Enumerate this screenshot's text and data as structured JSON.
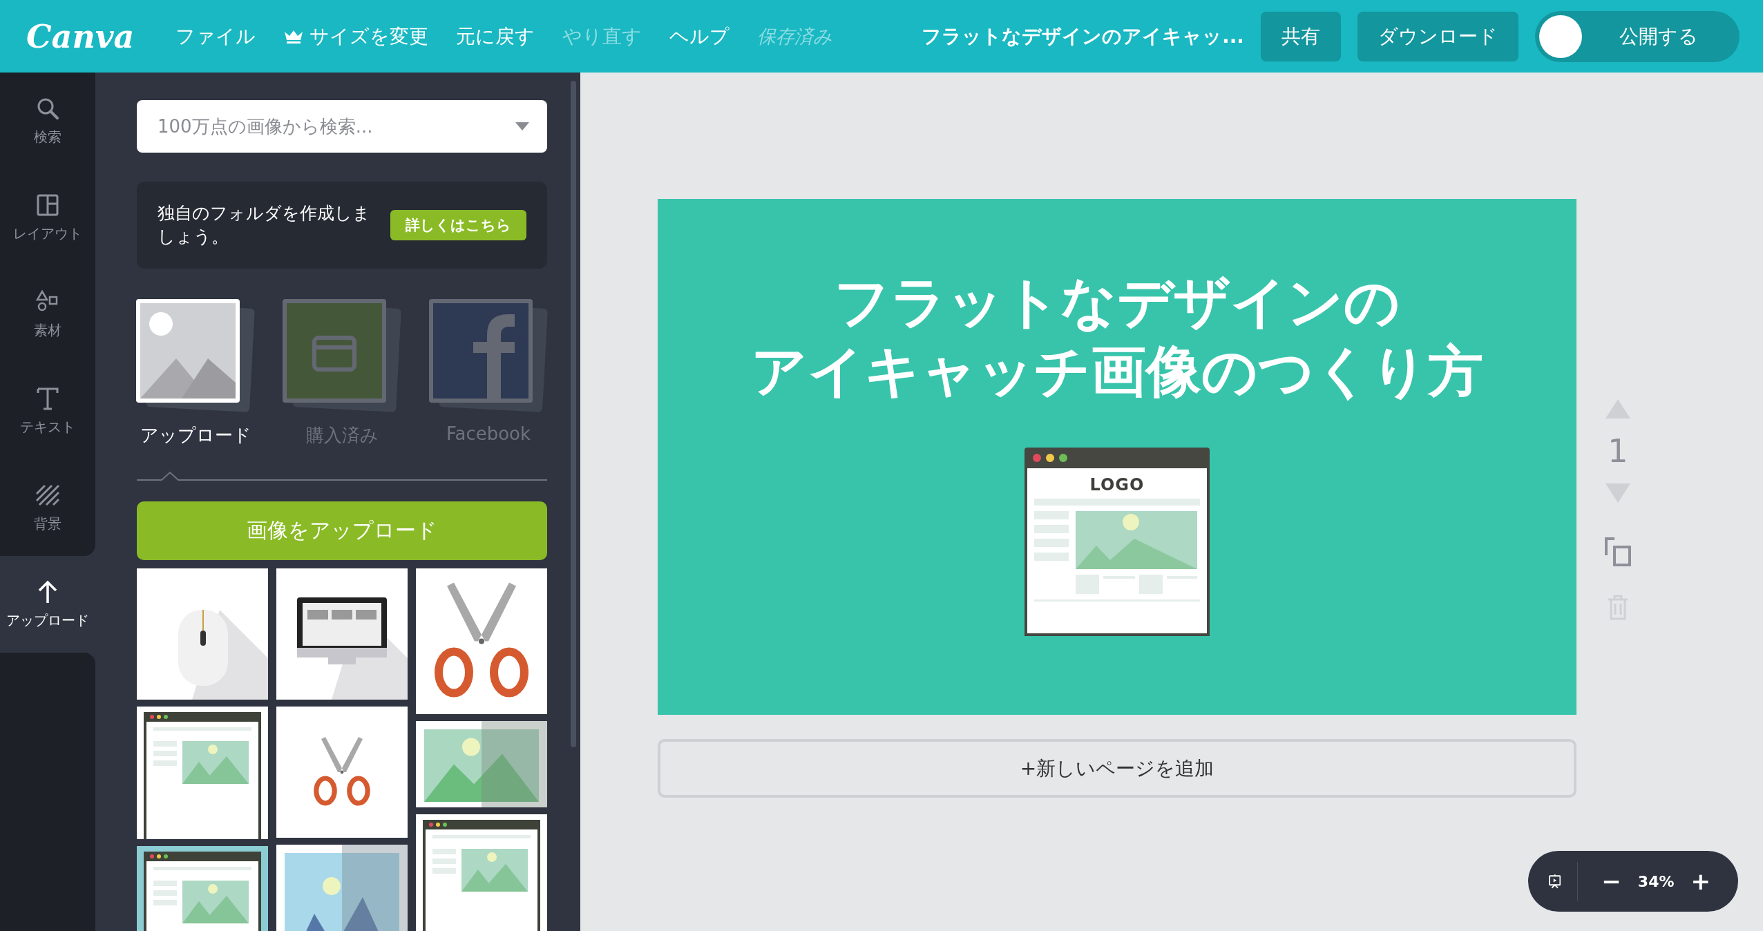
{
  "topbar": {
    "logo": "Canva",
    "menu": [
      {
        "label": "ファイル",
        "kind": "plain",
        "disabled": false
      },
      {
        "label": "サイズを変更",
        "kind": "crown",
        "disabled": false
      },
      {
        "label": "元に戻す",
        "kind": "plain",
        "disabled": false
      },
      {
        "label": "やり直す",
        "kind": "plain",
        "disabled": true
      },
      {
        "label": "ヘルプ",
        "kind": "plain",
        "disabled": false
      }
    ],
    "status": "保存済み",
    "doc_title": "フラットなデザインのアイキャッ...",
    "buttons": [
      "共有",
      "ダウンロード"
    ],
    "publish": {
      "label": "公開する",
      "on": false
    }
  },
  "sidebar": {
    "items": [
      {
        "label": "検索",
        "selected": false
      },
      {
        "label": "レイアウト",
        "selected": false
      },
      {
        "label": "素材",
        "selected": false
      },
      {
        "label": "テキスト",
        "selected": false
      },
      {
        "label": "背景",
        "selected": false
      },
      {
        "label": "アップロード",
        "selected": true
      }
    ]
  },
  "panel": {
    "search": {
      "placeholder": "100万点の画像から検索..."
    },
    "notice": {
      "text": "独自のフォルダを作成しましょう。",
      "button": "詳しくはこちら"
    },
    "sources": [
      {
        "label": "アップロード",
        "selected": true
      },
      {
        "label": "購入済み",
        "selected": false
      },
      {
        "label": "Facebook",
        "selected": false
      }
    ],
    "upload_button": "画像をアップロード"
  },
  "design": {
    "title_lines": [
      "フラットなデザインの",
      "アイキャッチ画像のつくり方"
    ],
    "illustration_logo": "LOGO"
  },
  "add_page": "+新しいページを追加",
  "page_controls": {
    "page_number": "1",
    "up_disabled": true,
    "down_disabled": true,
    "delete_disabled": true
  },
  "zoom": {
    "minus": "−",
    "value": "34%",
    "plus": "+"
  }
}
